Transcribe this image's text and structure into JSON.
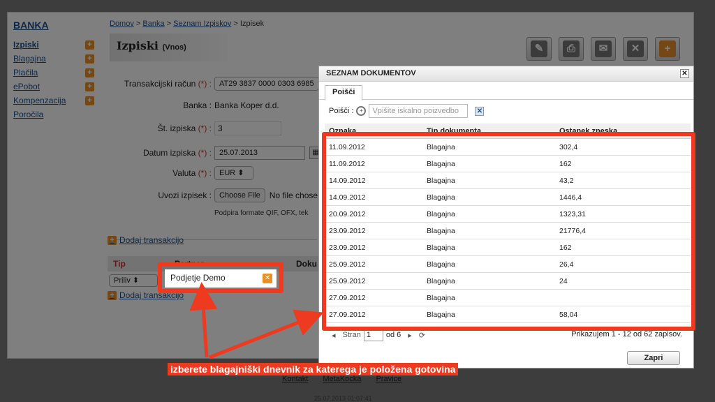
{
  "sidebar": {
    "brand": "BANKA",
    "items": [
      {
        "label": "Izpiski",
        "active": true,
        "plus": true
      },
      {
        "label": "Blagajna",
        "plus": true
      },
      {
        "label": "Plačila",
        "plus": true
      },
      {
        "label": "ePobot",
        "plus": true
      },
      {
        "label": "Kompenzacija",
        "plus": true
      },
      {
        "label": "Poročila",
        "plus": false
      }
    ]
  },
  "breadcrumb": {
    "home": "Domov",
    "sep": ">",
    "bank": "Banka",
    "list": "Seznam Izpiskov",
    "current": "Izpisek"
  },
  "page": {
    "title": "Izpiski",
    "subtitle": "(Vnos)"
  },
  "toolbar": [
    "pencil-icon",
    "print-icon",
    "mail-icon",
    "delete-icon",
    "add-icon"
  ],
  "form": {
    "account_label": "Transakcijski račun",
    "account_value": "AT29 3837 0000 0303 6985",
    "bank_label": "Banka :",
    "bank_value": "Banka Koper d.d.",
    "number_label": "Št. izpiska",
    "number_value": "3",
    "date_label": "Datum izpiska",
    "date_value": "25.07.2013",
    "currency_label": "Valuta",
    "currency_value": "EUR",
    "import_label": "Uvozi izpisek :",
    "choose_file": "Choose File",
    "no_file": "No file chose",
    "formats_note": "Podpira formate QIF, OFX, tek",
    "required_mark": "(*) :"
  },
  "transactions": {
    "add_label": "Dodaj transakcijo",
    "col_type": "Tip",
    "col_partner": "Partner",
    "col_doc": "Doku",
    "row_type": "Priliv",
    "row_partner": "Podjetje Demo"
  },
  "dialog": {
    "title": "SEZNAM DOKUMENTOV",
    "tab": "Poišči",
    "search_label": "Poišči :",
    "search_placeholder": "Vpišite iskalno poizvedbo",
    "columns": [
      "Oznaka",
      "Tip dokumenta",
      "Ostanek zneska"
    ],
    "rows": [
      [
        "11.09.2012",
        "Blagajna",
        "302,4"
      ],
      [
        "11.09.2012",
        "Blagajna",
        "162"
      ],
      [
        "14.09.2012",
        "Blagajna",
        "43,2"
      ],
      [
        "14.09.2012",
        "Blagajna",
        "1446,4"
      ],
      [
        "20.09.2012",
        "Blagajna",
        "1323,31"
      ],
      [
        "23.09.2012",
        "Blagajna",
        "21776,4"
      ],
      [
        "23.09.2012",
        "Blagajna",
        "162"
      ],
      [
        "25.09.2012",
        "Blagajna",
        "26,4"
      ],
      [
        "25.09.2012",
        "Blagajna",
        "24"
      ],
      [
        "27.09.2012",
        "Blagajna",
        ""
      ],
      [
        "27.09.2012",
        "Blagajna",
        "58,04"
      ]
    ],
    "pager": {
      "page_label": "Stran",
      "page": "1",
      "of": "od 6",
      "info": "Prikazujem 1 - 12 od 62 zapisov."
    },
    "close": "Zapri"
  },
  "caption": "izberete blagajniški dnevnik za katerega je položena gotovina",
  "footer": {
    "links": [
      "Kontakt",
      "MetaKocka",
      "Pravice"
    ],
    "time": "25.07.2013 01:07:41"
  },
  "colors": {
    "highlight": "#ee3a1e",
    "accent": "#e8912a",
    "link": "#1e4f8c"
  }
}
